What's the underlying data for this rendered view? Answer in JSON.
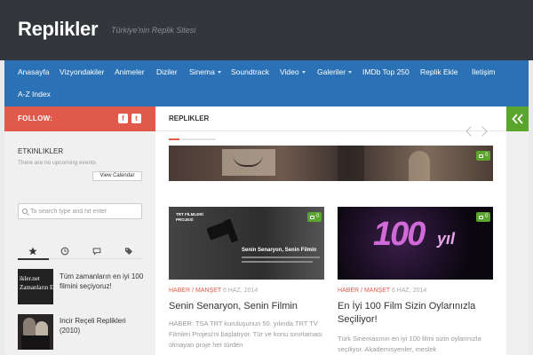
{
  "site": {
    "title": "Replikler",
    "tagline": "Türkiye'nin Replik Sitesi"
  },
  "nav": [
    {
      "label": "Anasayfa"
    },
    {
      "label": "Vizyondakiler"
    },
    {
      "label": "Animeler"
    },
    {
      "label": "Diziler"
    },
    {
      "label": "Sinema"
    },
    {
      "label": "Soundtrack"
    },
    {
      "label": "Video"
    },
    {
      "label": "Galeriler"
    },
    {
      "label": "IMDb Top 250"
    },
    {
      "label": "Replik Ekle"
    },
    {
      "label": "İletişim"
    },
    {
      "label": "A-Z Index"
    }
  ],
  "sidebar": {
    "follow": "FOLLOW:",
    "events_title": "ETKINLIKLER",
    "events_empty": "There are no upcoming events",
    "view_calendar": "View Calendar",
    "search_placeholder": "To search type and hit enter",
    "posts": [
      {
        "title": "Tüm zamanların en iyi 100 filmini seçiyoruz!",
        "thumb_text": "ikler.net\nZamanların En"
      },
      {
        "title": "Incir Reçeli Replikleri (2010)"
      }
    ]
  },
  "content": {
    "section": "REPLIKLER",
    "featured_comments": "0",
    "cards": [
      {
        "comments": "0",
        "cat1": "HABER",
        "cat2": "MANŞET",
        "date": "6 HAZ, 2014",
        "title": "Senin Senaryon, Senin Filmin",
        "excerpt": "HABER: TSA TRT kuruluşunun 50. yılında TRT TV Filmleri Projesi'ni başlatıyor. Tür ve konu sınırlaması olmayan proje her türden",
        "img_heading": "Senin Senaryon, Senin Filmin",
        "img_logo": "TRT FİLMLERİ PROJESİ"
      },
      {
        "comments": "0",
        "cat1": "HABER",
        "cat2": "MANŞET",
        "date": "6 HAZ, 2014",
        "title": "En İyi 100 Film Sizin Oylarınızla Seçiliyor!",
        "excerpt": "Türk Sinemasının en iyi 100 filmi sizin oylarınızla seçiliyor. Akademisyenler, meslek",
        "img_big": "100",
        "img_word": "yıl"
      }
    ]
  },
  "colors": {
    "nav": "#2a72b5",
    "follow": "#e0594a",
    "accent_green": "#5aa52c",
    "topbar": "#33363b"
  }
}
